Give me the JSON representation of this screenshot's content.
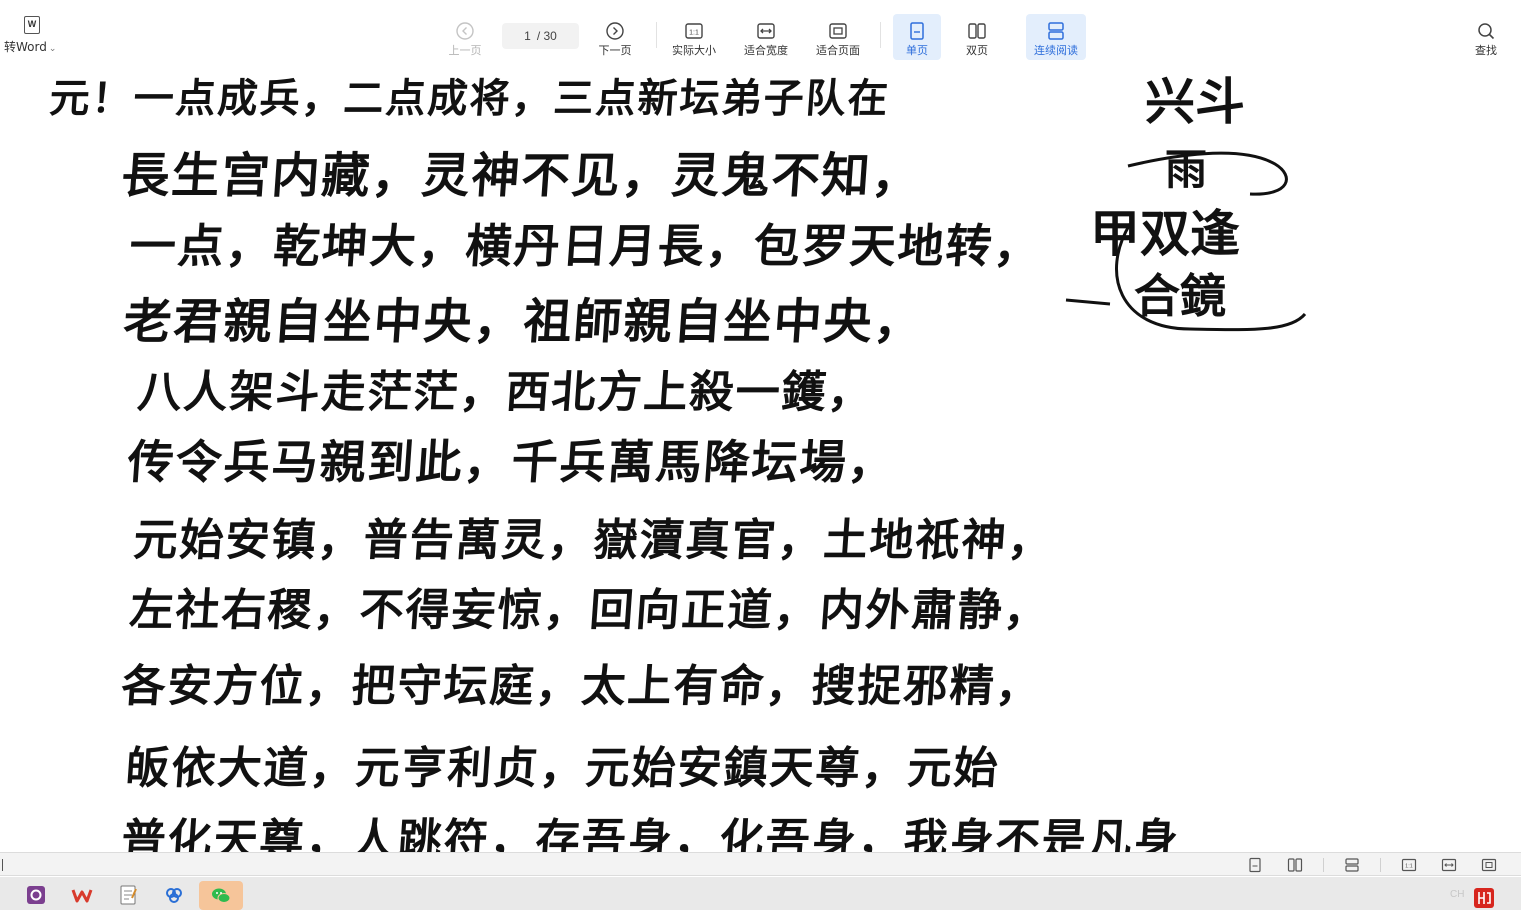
{
  "toolbar": {
    "to_word_label": "转Word",
    "word_icon_letter": "W",
    "prev_label": "上一页",
    "current_page": "1",
    "total_pages": "/ 30",
    "next_label": "下一页",
    "actual_size_label": "实际大小",
    "actual_size_icon_text": "1:1",
    "fit_width_label": "适合宽度",
    "fit_page_label": "适合页面",
    "single_page_label": "单页",
    "double_page_label": "双页",
    "continuous_label": "连续阅读",
    "search_label": "查找",
    "accent_color": "#2f6fdb",
    "active_bg": "#e3eefc"
  },
  "document": {
    "lines": [
      "元！一点成兵，二点成将，三点新坛弟子队在",
      "長生宫内藏，灵神不见，灵鬼不知，",
      "一点，乾坤大，横丹日月長，包罗天地转，",
      "老君親自坐中央，祖師親自坐中央，",
      "八人架斗走茫茫，西北方上殺一鑊，",
      "传令兵马親到此，千兵萬馬降坛場，",
      "元始安镇，普告萬灵，嶽瀆真官，土地祇神，",
      "左社右稷，不得妄惊，回向正道，内外肅静，",
      "各安方位，把守坛庭，太上有命，搜捉邪精，",
      "皈依大道，元亨利贞，元始安鎮天尊，元始",
      "普化天尊，人跳符，存吾身，化吾身，我身不是凡身"
    ],
    "side_note": {
      "top": "兴斗",
      "mid": "雨",
      "line1": "甲双逢",
      "line2": "合鏡"
    }
  },
  "statusbar": {
    "icons": [
      "single-page-icon",
      "double-page-icon",
      "continuous-icon",
      "actual-size-icon",
      "fit-width-icon",
      "fit-page-icon"
    ]
  },
  "taskbar": {
    "apps": [
      "onenote-app",
      "wps-app",
      "notepad-app",
      "baidu-netdisk-app",
      "wechat-app"
    ],
    "tray_text": "CH"
  }
}
